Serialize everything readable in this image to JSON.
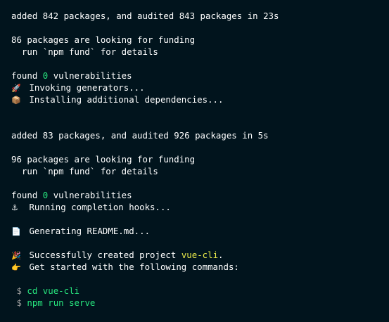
{
  "colors": {
    "background": "#01141d",
    "text": "#ffffff",
    "zero_highlight": "#27e57e",
    "project_highlight": "#e8e84a",
    "command": "#27e57e",
    "prompt": "#9a9a9a"
  },
  "block1": {
    "added": "added 842 packages, and audited 843 packages in 23s",
    "funding": "86 packages are looking for funding",
    "funding_hint": "  run `npm fund` for details",
    "found_prefix": "found ",
    "found_count": "0",
    "found_suffix": " vulnerabilities",
    "invoking": {
      "icon": "rocket-icon",
      "glyph": "🚀",
      "text": "Invoking generators..."
    },
    "installing": {
      "icon": "package-icon",
      "glyph": "📦",
      "text": "Installing additional dependencies..."
    }
  },
  "block2": {
    "added": "added 83 packages, and audited 926 packages in 5s",
    "funding": "96 packages are looking for funding",
    "funding_hint": "  run `npm fund` for details",
    "found_prefix": "found ",
    "found_count": "0",
    "found_suffix": " vulnerabilities",
    "hooks": {
      "icon": "anchor-icon",
      "glyph": "⚓",
      "text": "Running completion hooks..."
    },
    "readme": {
      "icon": "document-icon",
      "glyph": "📄",
      "text": "Generating README.md..."
    }
  },
  "result": {
    "success": {
      "icon": "party-popper-icon",
      "glyph": "🎉",
      "prefix": "Successfully created project ",
      "project": "vue-cli",
      "suffix": "."
    },
    "get_started": {
      "icon": "pointing-hand-icon",
      "glyph": "👉",
      "text": "Get started with the following commands:"
    }
  },
  "commands": [
    {
      "prompt": " $ ",
      "text": "cd vue-cli"
    },
    {
      "prompt": " $ ",
      "text": "npm run serve"
    }
  ]
}
